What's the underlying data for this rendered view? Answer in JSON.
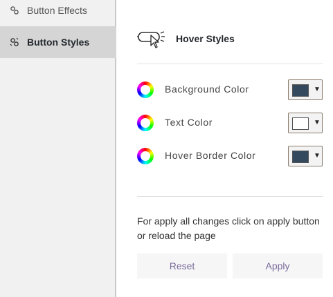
{
  "sidebar": {
    "items": [
      {
        "label": "Button Effects",
        "icon": "link-icon",
        "active": false
      },
      {
        "label": "Button Styles",
        "icon": "magic-link-icon",
        "active": true
      }
    ]
  },
  "panel": {
    "title": "Hover Styles",
    "header_icon": "hand-pointer-icon",
    "rows": [
      {
        "label": "Background Color",
        "color": "#34495e"
      },
      {
        "label": "Text Color",
        "color": "#ffffff"
      },
      {
        "label": "Hover Border Color",
        "color": "#34495e"
      }
    ],
    "caret": "▼",
    "note": "For apply all changes click on apply button or reload the page",
    "reset_label": "Reset",
    "apply_label": "Apply"
  }
}
